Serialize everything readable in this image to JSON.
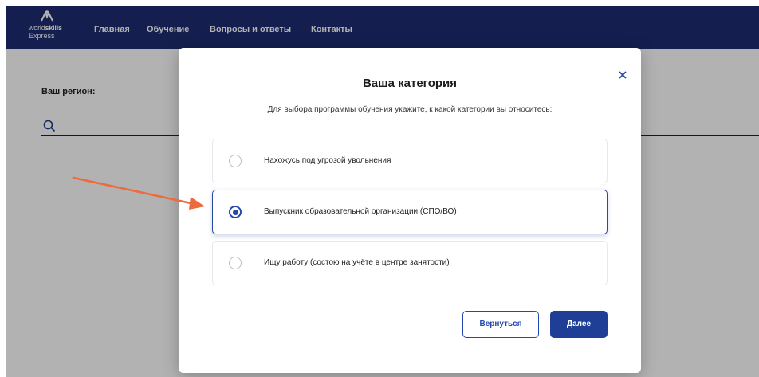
{
  "logo": {
    "line1_a": "world",
    "line1_b": "skills",
    "line2": "Express"
  },
  "nav": {
    "items": [
      "Главная",
      "Обучение",
      "Вопросы и ответы",
      "Контакты"
    ]
  },
  "page": {
    "region_label": "Ваш регион:"
  },
  "modal": {
    "title": "Ваша категория",
    "subtitle": "Для выбора программы обучения укажите, к какой категории вы относитесь:",
    "options": [
      {
        "label": "Нахожусь под угрозой увольнения",
        "selected": false
      },
      {
        "label": "Выпускник образовательной организации (СПО/ВО)",
        "selected": true
      },
      {
        "label": "Ищу работу (состою на учёте в центре занятости)",
        "selected": false
      }
    ],
    "back_label": "Вернуться",
    "next_label": "Далее"
  },
  "colors": {
    "navbar": "#1e2d72",
    "accent": "#2548b0",
    "annotation_arrow": "#ee6a3c"
  },
  "icons": {
    "close": "close-icon",
    "search": "search-icon",
    "arrow": "annotation-arrow-icon"
  }
}
